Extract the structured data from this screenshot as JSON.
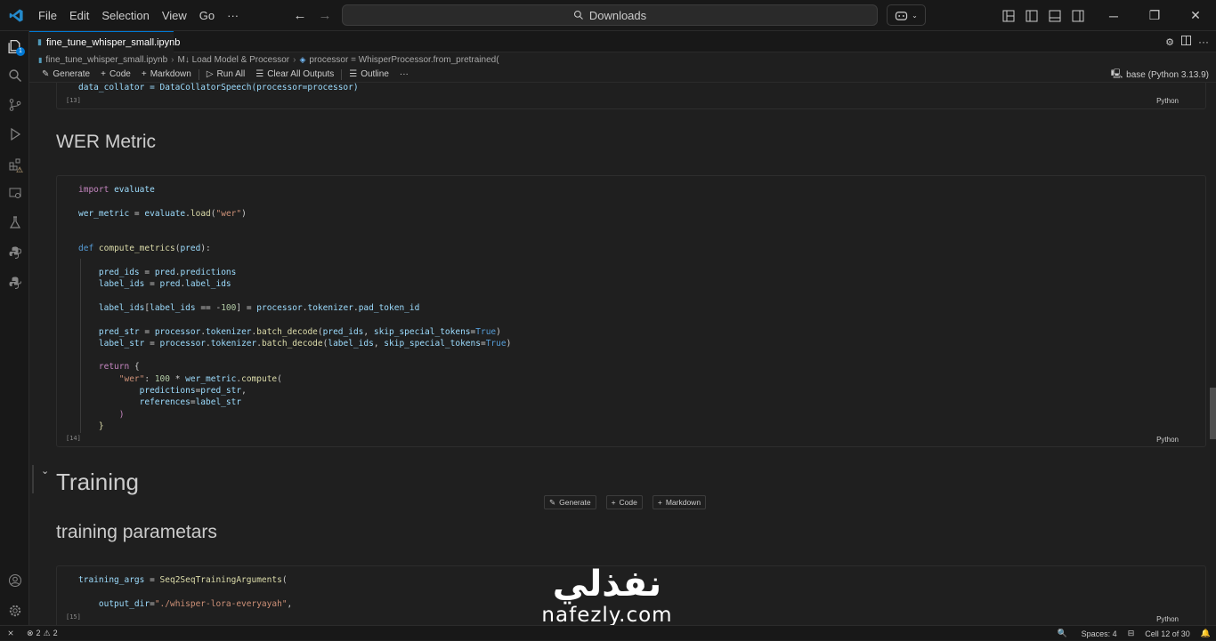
{
  "menu": [
    "File",
    "Edit",
    "Selection",
    "View",
    "Go",
    "···"
  ],
  "search": {
    "text": "Downloads"
  },
  "tab": {
    "label": "fine_tune_whisper_small.ipynb"
  },
  "breadcrumb": [
    "fine_tune_whisper_small.ipynb",
    "M↓ Load Model & Processor",
    "processor = WhisperProcessor.from_pretrained("
  ],
  "toolbar": {
    "generate": "Generate",
    "code": "Code",
    "markdown": "Markdown",
    "run_all": "Run All",
    "clear_outputs": "Clear All Outputs",
    "outline": "Outline",
    "kernel": "base (Python 3.13.9)"
  },
  "cells": {
    "c13": {
      "code_line": "data_collator = DataCollatorSpeech(processor=processor)",
      "count": "[13]",
      "lang": "Python"
    },
    "wer_heading": "WER Metric",
    "c14": {
      "count": "[14]",
      "lang": "Python"
    },
    "training_heading": "Training",
    "training_params_heading": "training parametars",
    "c15": {
      "count": "[15]",
      "lang": "Python"
    }
  },
  "insert": {
    "generate": "Generate",
    "code": "Code",
    "markdown": "Markdown"
  },
  "status": {
    "errors": "2",
    "warnings": "2",
    "spaces": "Spaces: 4",
    "cell": "Cell 12 of 30"
  },
  "watermark": {
    "arabic": "نفذلي",
    "latin": "nafezly.com"
  },
  "colors": {
    "accent": "#0078d4",
    "keyword": "#c586c0",
    "function": "#dcdcaa",
    "string": "#ce9178",
    "variable": "#9cdcfe"
  }
}
